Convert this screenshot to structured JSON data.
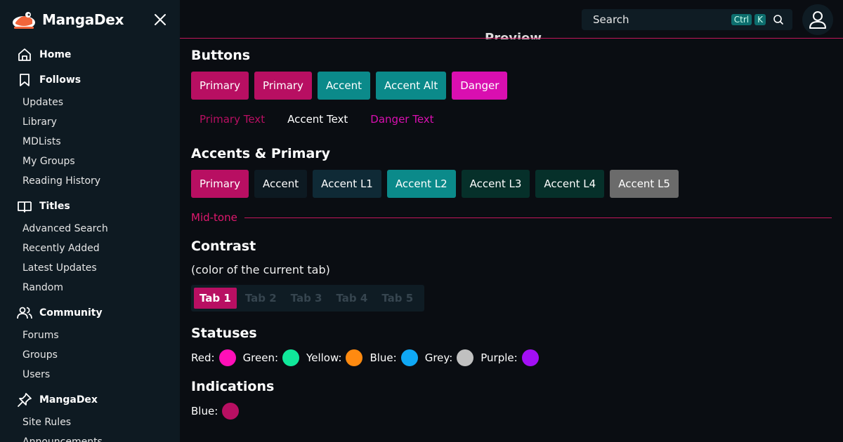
{
  "brand": {
    "name": "MangaDex"
  },
  "sidebar": {
    "groups": [
      {
        "title": "Home",
        "icon": "home-icon",
        "items": []
      },
      {
        "title": "Follows",
        "icon": "bookmark-icon",
        "items": [
          "Updates",
          "Library",
          "MDLists",
          "My Groups",
          "Reading History"
        ]
      },
      {
        "title": "Titles",
        "icon": "book-open-icon",
        "items": [
          "Advanced Search",
          "Recently Added",
          "Latest Updates",
          "Random"
        ]
      },
      {
        "title": "Community",
        "icon": "users-icon",
        "items": [
          "Forums",
          "Groups",
          "Users"
        ]
      },
      {
        "title": "MangaDex",
        "icon": "pin-icon",
        "items": [
          "Site Rules",
          "Announcements"
        ]
      }
    ]
  },
  "search": {
    "placeholder": "Search",
    "kbd_ctrl": "Ctrl",
    "kbd_k": "K"
  },
  "preview_heading": "Preview",
  "buttons": {
    "title": "Buttons",
    "filled": [
      {
        "label": "Primary",
        "color": "#b80f62"
      },
      {
        "label": "Primary",
        "color": "#b80f62"
      },
      {
        "label": "Accent",
        "color": "#0b8a8a"
      },
      {
        "label": "Accent Alt",
        "color": "#0b8a8a"
      },
      {
        "label": "Danger",
        "color": "#d90fb0"
      }
    ],
    "text": [
      {
        "label": "Primary Text",
        "color": "#b80f62"
      },
      {
        "label": "Accent Text",
        "color": "#ffffff"
      },
      {
        "label": "Danger Text",
        "color": "#d90fb0"
      }
    ]
  },
  "accents": {
    "title": "Accents & Primary",
    "items": [
      {
        "label": "Primary",
        "color": "#b80f62"
      },
      {
        "label": "Accent",
        "color": "#0d1a22"
      },
      {
        "label": "Accent L1",
        "color": "#0f2a36"
      },
      {
        "label": "Accent L2",
        "color": "#0b8a8a"
      },
      {
        "label": "Accent L3",
        "color": "#06302a"
      },
      {
        "label": "Accent L4",
        "color": "#06302a"
      },
      {
        "label": "Accent L5",
        "color": "#6b6b6b"
      }
    ]
  },
  "midtone": {
    "label": "Mid-tone"
  },
  "contrast": {
    "title": "Contrast",
    "subtitle": "(color of the current tab)",
    "tabs": [
      "Tab 1",
      "Tab 2",
      "Tab 3",
      "Tab 4",
      "Tab 5"
    ],
    "active_tab": 0
  },
  "statuses": {
    "title": "Statuses",
    "items": [
      {
        "label": "Red:",
        "color": "#ff0fb8"
      },
      {
        "label": "Green:",
        "color": "#10e89a"
      },
      {
        "label": "Yellow:",
        "color": "#ff8a10"
      },
      {
        "label": "Blue:",
        "color": "#0fa8f5"
      },
      {
        "label": "Grey:",
        "color": "#c0c0c0"
      },
      {
        "label": "Purple:",
        "color": "#a30ff5"
      }
    ]
  },
  "indications": {
    "title": "Indications",
    "items": [
      {
        "label": "Blue:",
        "color": "#b80f62"
      }
    ]
  }
}
